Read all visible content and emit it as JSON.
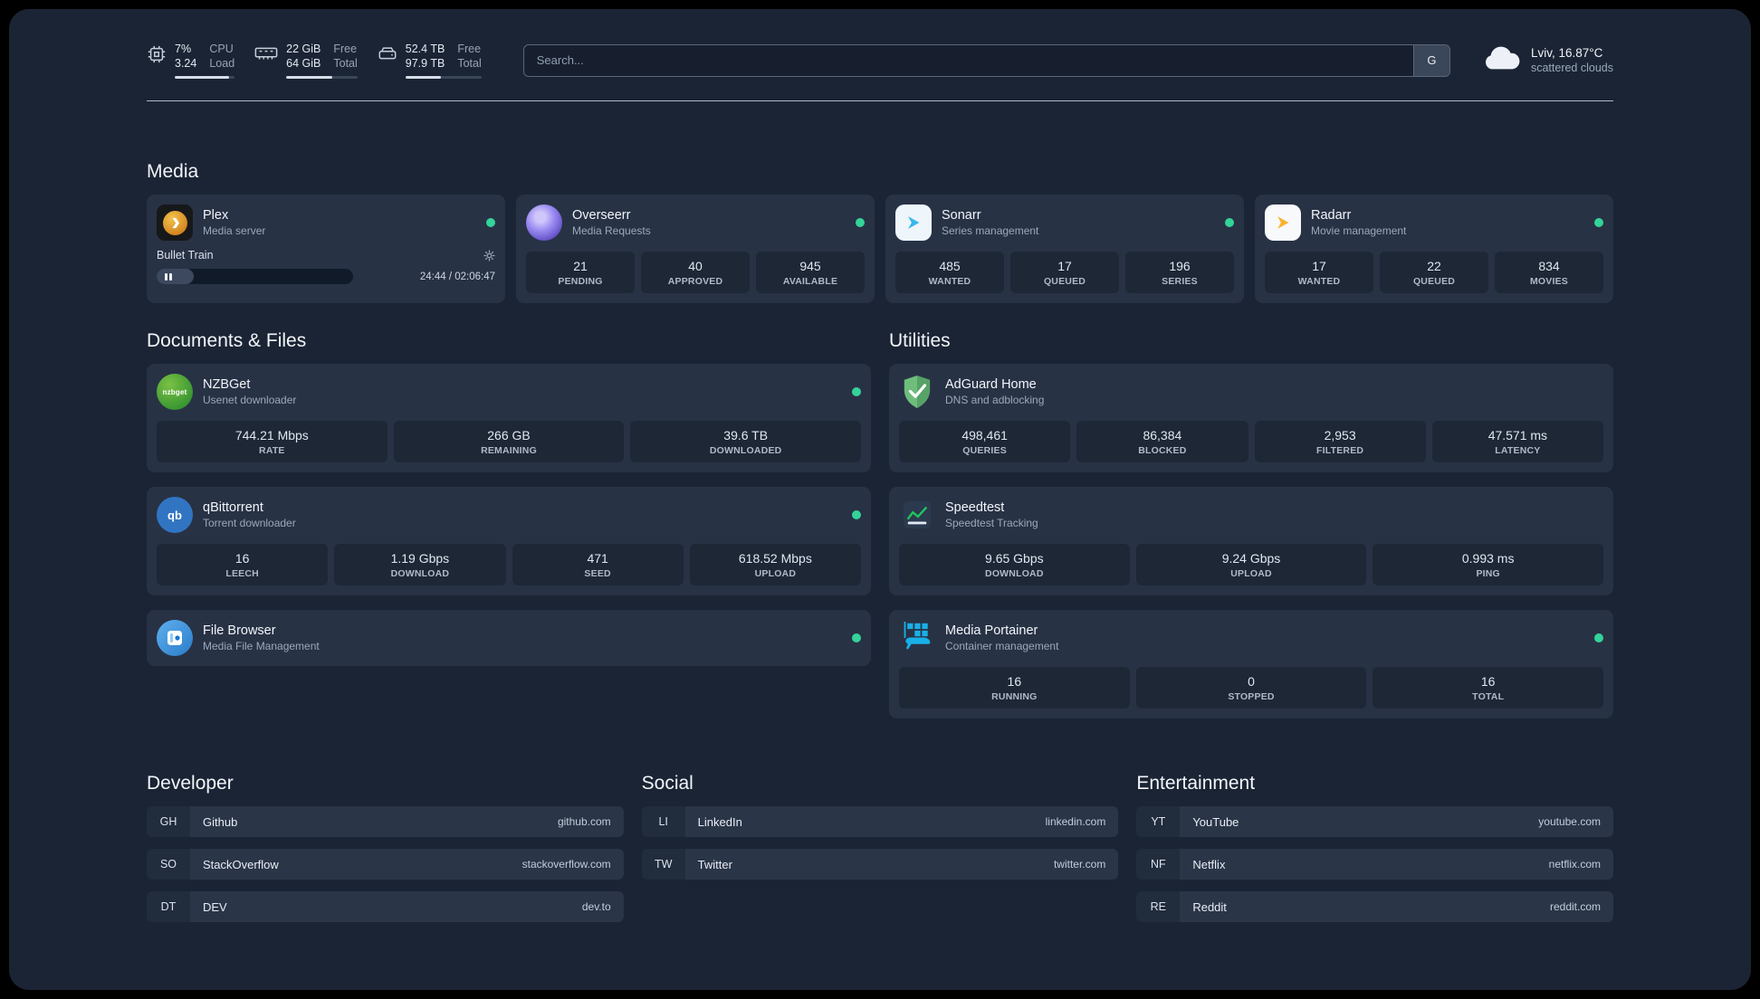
{
  "colors": {
    "status": "#34d399",
    "page_bg": "#1b2434",
    "card_bg": "#283245",
    "tile_bg": "#1d2736"
  },
  "topbar": {
    "cpu": {
      "percent": "7%",
      "load": "3.24",
      "label1": "CPU",
      "label2": "Load",
      "bar": 90
    },
    "memory": {
      "free": "22 GiB",
      "total": "64 GiB",
      "label1": "Free",
      "label2": "Total",
      "bar": 65
    },
    "disk": {
      "free": "52.4 TB",
      "total": "97.9 TB",
      "label1": "Free",
      "label2": "Total",
      "bar": 47
    },
    "search": {
      "placeholder": "Search...",
      "button": "G"
    },
    "weather": {
      "location": "Lviv, 16.87°C",
      "condition": "scattered clouds"
    }
  },
  "sections": {
    "media": "Media",
    "documents": "Documents & Files",
    "utilities": "Utilities",
    "developer": "Developer",
    "social": "Social",
    "entertainment": "Entertainment"
  },
  "services": {
    "plex": {
      "name": "Plex",
      "desc": "Media server",
      "now_playing": "Bullet Train",
      "time": "24:44 / 02:06:47",
      "progress": 19
    },
    "overseerr": {
      "name": "Overseerr",
      "desc": "Media Requests",
      "stats": [
        {
          "value": "21",
          "label": "PENDING"
        },
        {
          "value": "40",
          "label": "APPROVED"
        },
        {
          "value": "945",
          "label": "AVAILABLE"
        }
      ]
    },
    "sonarr": {
      "name": "Sonarr",
      "desc": "Series management",
      "stats": [
        {
          "value": "485",
          "label": "WANTED"
        },
        {
          "value": "17",
          "label": "QUEUED"
        },
        {
          "value": "196",
          "label": "SERIES"
        }
      ]
    },
    "radarr": {
      "name": "Radarr",
      "desc": "Movie management",
      "stats": [
        {
          "value": "17",
          "label": "WANTED"
        },
        {
          "value": "22",
          "label": "QUEUED"
        },
        {
          "value": "834",
          "label": "MOVIES"
        }
      ]
    },
    "nzbget": {
      "name": "NZBGet",
      "desc": "Usenet downloader",
      "icon_text": "nzbget",
      "stats": [
        {
          "value": "744.21 Mbps",
          "label": "RATE"
        },
        {
          "value": "266 GB",
          "label": "REMAINING"
        },
        {
          "value": "39.6 TB",
          "label": "DOWNLOADED"
        }
      ]
    },
    "qbittorrent": {
      "name": "qBittorrent",
      "desc": "Torrent downloader",
      "icon_text": "qb",
      "stats": [
        {
          "value": "16",
          "label": "LEECH"
        },
        {
          "value": "1.19 Gbps",
          "label": "DOWNLOAD"
        },
        {
          "value": "471",
          "label": "SEED"
        },
        {
          "value": "618.52 Mbps",
          "label": "UPLOAD"
        }
      ]
    },
    "filebrowser": {
      "name": "File Browser",
      "desc": "Media File Management"
    },
    "adguard": {
      "name": "AdGuard Home",
      "desc": "DNS and adblocking",
      "stats": [
        {
          "value": "498,461",
          "label": "QUERIES"
        },
        {
          "value": "86,384",
          "label": "BLOCKED"
        },
        {
          "value": "2,953",
          "label": "FILTERED"
        },
        {
          "value": "47.571 ms",
          "label": "LATENCY"
        }
      ]
    },
    "speedtest": {
      "name": "Speedtest",
      "desc": "Speedtest Tracking",
      "stats": [
        {
          "value": "9.65 Gbps",
          "label": "DOWNLOAD"
        },
        {
          "value": "9.24 Gbps",
          "label": "UPLOAD"
        },
        {
          "value": "0.993 ms",
          "label": "PING"
        }
      ]
    },
    "portainer": {
      "name": "Media Portainer",
      "desc": "Container management",
      "stats": [
        {
          "value": "16",
          "label": "RUNNING"
        },
        {
          "value": "0",
          "label": "STOPPED"
        },
        {
          "value": "16",
          "label": "TOTAL"
        }
      ]
    }
  },
  "bookmarks": {
    "developer": [
      {
        "abbr": "GH",
        "name": "Github",
        "domain": "github.com"
      },
      {
        "abbr": "SO",
        "name": "StackOverflow",
        "domain": "stackoverflow.com"
      },
      {
        "abbr": "DT",
        "name": "DEV",
        "domain": "dev.to"
      }
    ],
    "social": [
      {
        "abbr": "LI",
        "name": "LinkedIn",
        "domain": "linkedin.com"
      },
      {
        "abbr": "TW",
        "name": "Twitter",
        "domain": "twitter.com"
      }
    ],
    "entertainment": [
      {
        "abbr": "YT",
        "name": "YouTube",
        "domain": "youtube.com"
      },
      {
        "abbr": "NF",
        "name": "Netflix",
        "domain": "netflix.com"
      },
      {
        "abbr": "RE",
        "name": "Reddit",
        "domain": "reddit.com"
      }
    ]
  }
}
